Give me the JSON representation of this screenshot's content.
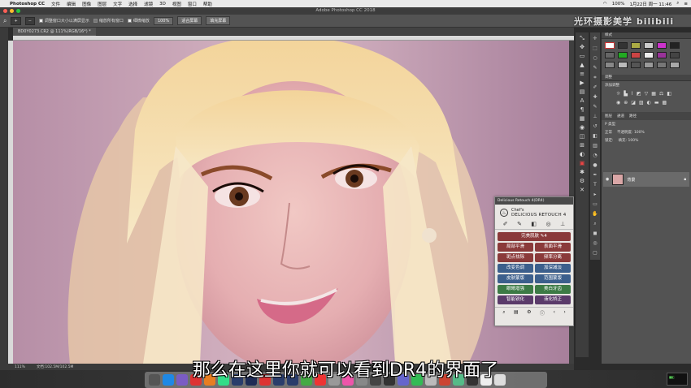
{
  "menubar": {
    "app": "Photoshop CC",
    "items": [
      "文件",
      "编辑",
      "图像",
      "图层",
      "文字",
      "选择",
      "滤镜",
      "3D",
      "视图",
      "窗口",
      "帮助"
    ],
    "battery": "100%",
    "clock": "1月22日 周一 11:46"
  },
  "window": {
    "title": "Adobe Photoshop CC 2018"
  },
  "options": {
    "zoom_box": "Q",
    "resize_window_label": "调整窗口大小以满屏显示",
    "zoom_all_label": "缩放所有窗口",
    "scrubby_label": "细微缩放",
    "zoom_value": "100%",
    "fit_screen": "适合屏幕",
    "fill_screen": "填充屏幕"
  },
  "document": {
    "tab": "BD0Y0273.CR2 @ 111%(RGB/16*) *"
  },
  "status": {
    "zoom": "111%",
    "doc_info": "文档:102.5M/102.5M"
  },
  "subtitle": "那么在这里你就可以看到DR4的界面了",
  "watermark": "光环摄影美学 bilibili",
  "right_panels": {
    "swatches_tab": "样式",
    "adjust_tab": "调整",
    "adjust_label": "添加调整",
    "layers_tabs": [
      "图层",
      "通道",
      "路径"
    ],
    "layer_kind": "P 类型",
    "blend_mode": "正常",
    "opacity": "不透明度: 100%",
    "fill": "填充: 100%",
    "lock": "锁定:",
    "layer_name": "背景"
  },
  "dr_panel": {
    "header": "Delicious Retouch 4(DR4)",
    "brand_line1": "Chef's",
    "brand_line2": "DELICIOUS RETOUCH 4",
    "buttons": [
      {
        "label": "完美肌肤 ✎4",
        "color": "#8a3a3a",
        "wide": true
      },
      {
        "label": "局部平滑",
        "color": "#8a3a3a"
      },
      {
        "label": "表面平滑",
        "color": "#8a3a3a"
      },
      {
        "label": "斑点祛除",
        "color": "#8a3a3a"
      },
      {
        "label": "频率分离",
        "color": "#8a3a3a"
      },
      {
        "label": "改变色调",
        "color": "#3c5f8c"
      },
      {
        "label": "加深减淡",
        "color": "#3c5f8c"
      },
      {
        "label": "皮肤蒙版",
        "color": "#3c5f8c"
      },
      {
        "label": "范围蒙版",
        "color": "#3c5f8c"
      },
      {
        "label": "眼睛增强",
        "color": "#3c7a45"
      },
      {
        "label": "美白牙齿",
        "color": "#3c7a45"
      },
      {
        "label": "智能锐化",
        "color": "#5a3a6a"
      },
      {
        "label": "液化矫正",
        "color": "#5a3a6a"
      }
    ]
  },
  "colors": {
    "accent": "#8a3a3a",
    "panel_bg": "#535353"
  }
}
